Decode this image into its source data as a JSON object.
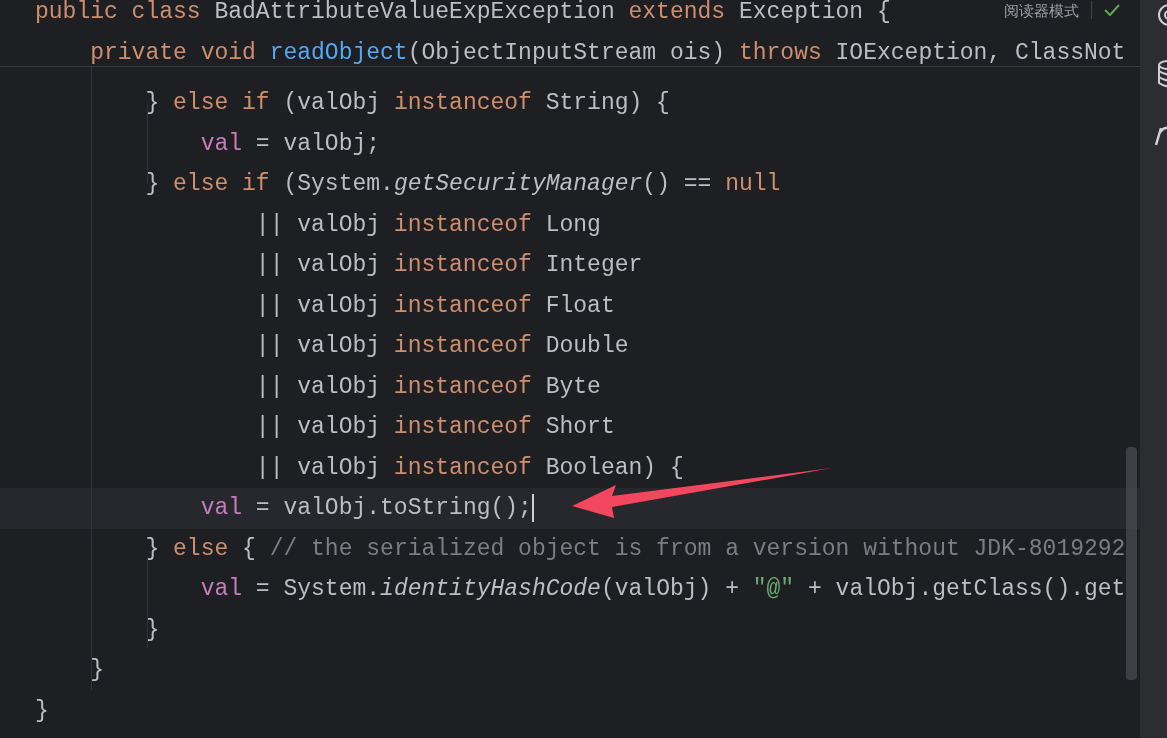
{
  "sticky_lines": [
    {
      "tokens": [
        {
          "kind": "keyword",
          "text": "public class "
        },
        {
          "kind": "plain",
          "text": "BadAttributeValueExpException "
        },
        {
          "kind": "keyword",
          "text": "extends "
        },
        {
          "kind": "plain",
          "text": "Exception {"
        }
      ]
    },
    {
      "tokens": [
        {
          "kind": "keyword",
          "text": "    private void "
        },
        {
          "kind": "method",
          "text": "readObject"
        },
        {
          "kind": "plain",
          "text": "(ObjectInputStream ois) "
        },
        {
          "kind": "keyword",
          "text": "throws "
        },
        {
          "kind": "plain",
          "text": "IOException, ClassNot"
        }
      ]
    }
  ],
  "reader_mode": {
    "label": "阅读器模式",
    "inspection_ok": true
  },
  "code_lines": [
    {
      "current": false,
      "tokens": [
        {
          "kind": "plain",
          "text": "        } "
        },
        {
          "kind": "keyword",
          "text": "else if "
        },
        {
          "kind": "plain",
          "text": "(valObj "
        },
        {
          "kind": "keyword",
          "text": "instanceof "
        },
        {
          "kind": "plain",
          "text": "String) {"
        }
      ]
    },
    {
      "current": false,
      "tokens": [
        {
          "kind": "field",
          "text": "            val"
        },
        {
          "kind": "plain",
          "text": " = valObj;"
        }
      ]
    },
    {
      "current": false,
      "tokens": [
        {
          "kind": "plain",
          "text": "        } "
        },
        {
          "kind": "keyword",
          "text": "else if "
        },
        {
          "kind": "plain",
          "text": "(System."
        },
        {
          "kind": "static",
          "text": "getSecurityManager"
        },
        {
          "kind": "plain",
          "text": "() == "
        },
        {
          "kind": "keyword",
          "text": "null"
        }
      ]
    },
    {
      "current": false,
      "tokens": [
        {
          "kind": "plain",
          "text": "                || valObj "
        },
        {
          "kind": "keyword",
          "text": "instanceof "
        },
        {
          "kind": "plain",
          "text": "Long"
        }
      ]
    },
    {
      "current": false,
      "tokens": [
        {
          "kind": "plain",
          "text": "                || valObj "
        },
        {
          "kind": "keyword",
          "text": "instanceof "
        },
        {
          "kind": "plain",
          "text": "Integer"
        }
      ]
    },
    {
      "current": false,
      "tokens": [
        {
          "kind": "plain",
          "text": "                || valObj "
        },
        {
          "kind": "keyword",
          "text": "instanceof "
        },
        {
          "kind": "plain",
          "text": "Float"
        }
      ]
    },
    {
      "current": false,
      "tokens": [
        {
          "kind": "plain",
          "text": "                || valObj "
        },
        {
          "kind": "keyword",
          "text": "instanceof "
        },
        {
          "kind": "plain",
          "text": "Double"
        }
      ]
    },
    {
      "current": false,
      "tokens": [
        {
          "kind": "plain",
          "text": "                || valObj "
        },
        {
          "kind": "keyword",
          "text": "instanceof "
        },
        {
          "kind": "plain",
          "text": "Byte"
        }
      ]
    },
    {
      "current": false,
      "tokens": [
        {
          "kind": "plain",
          "text": "                || valObj "
        },
        {
          "kind": "keyword",
          "text": "instanceof "
        },
        {
          "kind": "plain",
          "text": "Short"
        }
      ]
    },
    {
      "current": false,
      "tokens": [
        {
          "kind": "plain",
          "text": "                || valObj "
        },
        {
          "kind": "keyword",
          "text": "instanceof "
        },
        {
          "kind": "plain",
          "text": "Boolean) {"
        }
      ]
    },
    {
      "current": true,
      "tokens": [
        {
          "kind": "field",
          "text": "            val"
        },
        {
          "kind": "plain",
          "text": " = valObj.toString();"
        }
      ]
    },
    {
      "current": false,
      "tokens": [
        {
          "kind": "plain",
          "text": "        } "
        },
        {
          "kind": "keyword",
          "text": "else "
        },
        {
          "kind": "plain",
          "text": "{ "
        },
        {
          "kind": "comment",
          "text": "// the serialized object is from a version without JDK-8019292"
        }
      ]
    },
    {
      "current": false,
      "tokens": [
        {
          "kind": "field",
          "text": "            val"
        },
        {
          "kind": "plain",
          "text": " = System."
        },
        {
          "kind": "static",
          "text": "identityHashCode"
        },
        {
          "kind": "plain",
          "text": "(valObj) + "
        },
        {
          "kind": "string",
          "text": "\"@\""
        },
        {
          "kind": "plain",
          "text": " + valObj.getClass().get"
        }
      ]
    },
    {
      "current": false,
      "tokens": [
        {
          "kind": "plain",
          "text": "        }"
        }
      ]
    },
    {
      "current": false,
      "tokens": [
        {
          "kind": "plain",
          "text": "    }"
        }
      ]
    },
    {
      "current": false,
      "tokens": [
        {
          "kind": "plain",
          "text": "}"
        }
      ]
    }
  ],
  "annotation": {
    "kind": "arrow"
  }
}
